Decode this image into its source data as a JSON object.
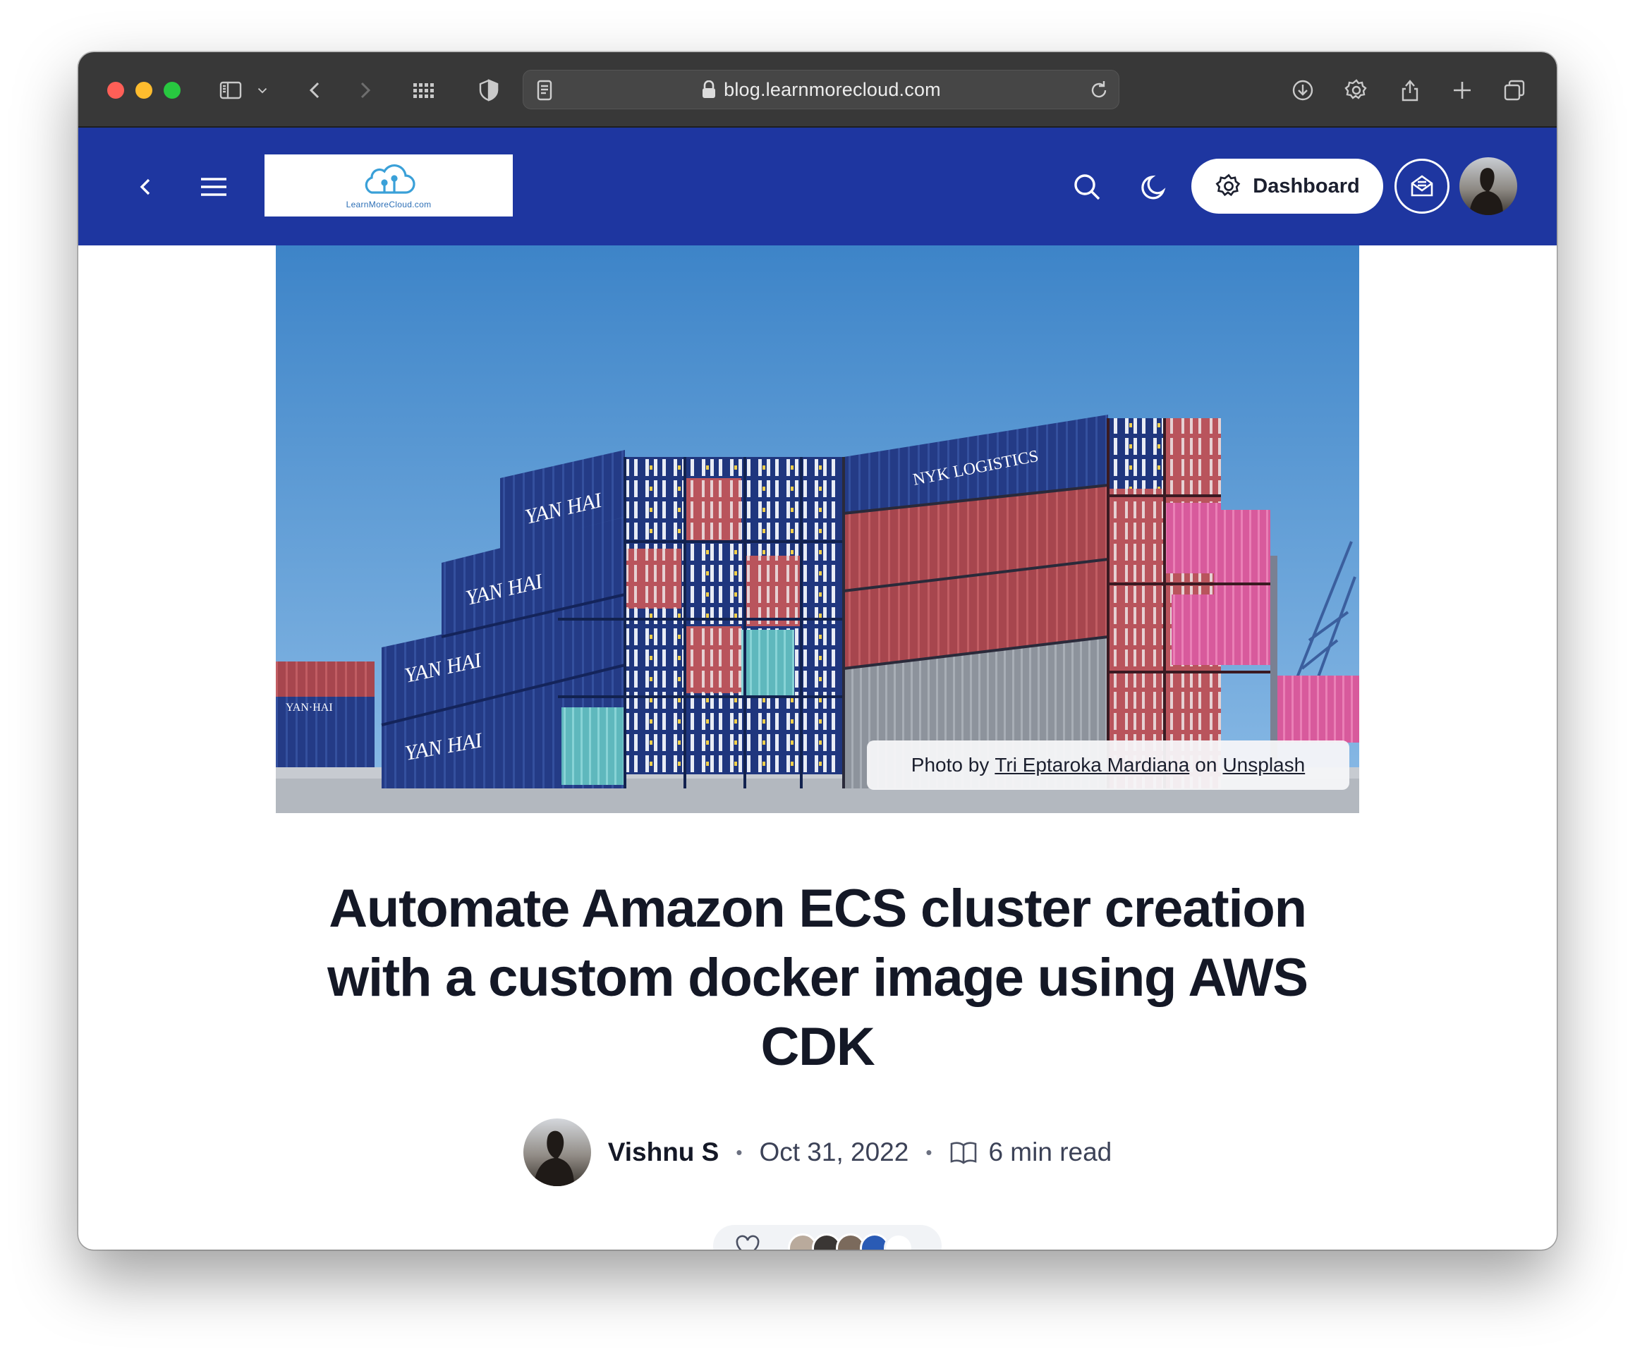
{
  "browser": {
    "url": "blog.learnmorecloud.com"
  },
  "header": {
    "logo_text": "LearnMoreCloud.com",
    "dashboard_label": "Dashboard"
  },
  "cover": {
    "credit_prefix": "Photo by",
    "credit_author": "Tri Eptaroka Mardiana",
    "credit_mid": "on",
    "credit_source": "Unsplash"
  },
  "article": {
    "title": "Automate Amazon ECS cluster creation with a custom docker image using AWS CDK",
    "author": "Vishnu S",
    "date": "Oct 31, 2022",
    "read_time": "6 min read"
  },
  "colors": {
    "header_bg": "#1e36a0",
    "toolbar_bg": "#383838",
    "title_color": "#141826"
  },
  "icons": {
    "toolbar": [
      "sidebar-icon",
      "chevron-down-icon",
      "back-icon",
      "forward-icon",
      "grid-icon",
      "shield-icon",
      "reader-icon",
      "lock-icon",
      "reload-icon",
      "download-icon",
      "gear-icon",
      "share-icon",
      "plus-icon",
      "tabs-icon"
    ],
    "header": [
      "back-icon",
      "menu-icon",
      "search-icon",
      "moon-icon",
      "gear-icon",
      "newsletter-icon"
    ]
  }
}
